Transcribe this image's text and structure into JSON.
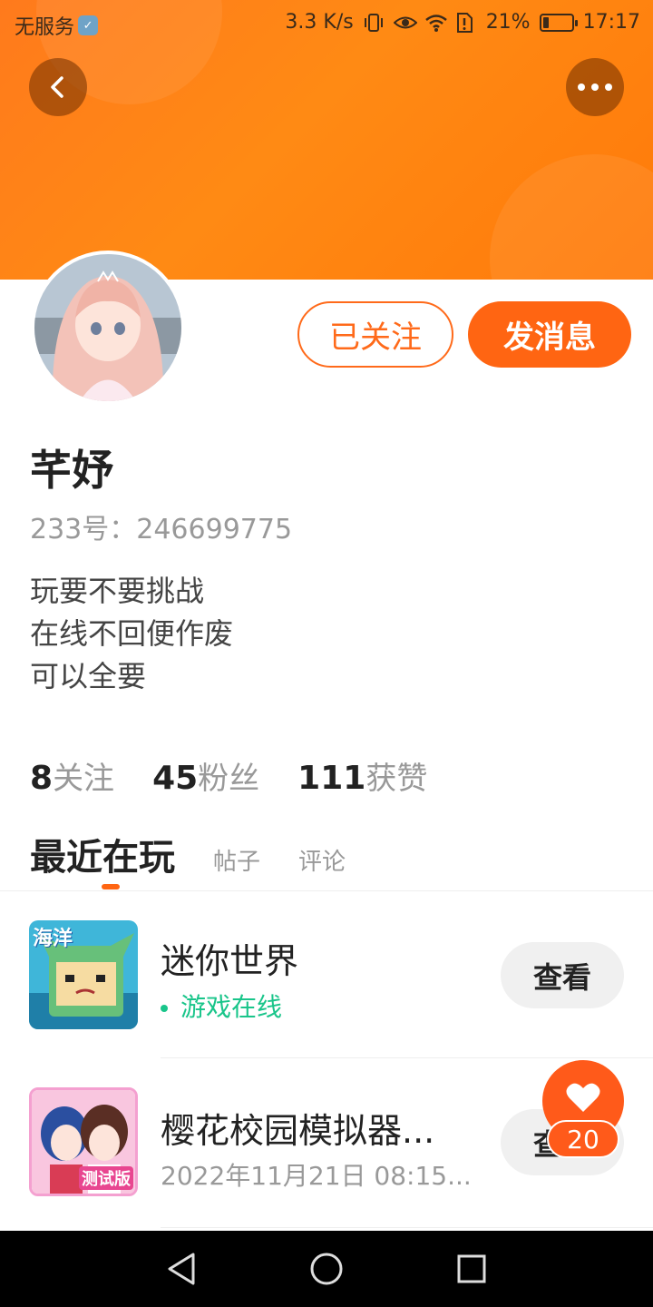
{
  "status_bar": {
    "carrier": "无服务",
    "network_speed": "3.3 K/s",
    "battery_percent": "21%",
    "battery_level": 0.21,
    "time": "17:17"
  },
  "profile": {
    "name": "芊妤",
    "id_label": "233号：246699775",
    "bio": [
      "玩要不要挑战",
      "在线不回便作废",
      "可以全要"
    ],
    "followed_label": "已关注",
    "message_label": "发消息"
  },
  "stats": [
    {
      "value": "8",
      "label": "关注"
    },
    {
      "value": "45",
      "label": "粉丝"
    },
    {
      "value": "111",
      "label": "获赞"
    }
  ],
  "tabs": {
    "recent": "最近在玩",
    "posts": "帖子",
    "comments": "评论"
  },
  "games": [
    {
      "title": "迷你世界",
      "status": "游戏在线",
      "button": "查看",
      "icon_text": "海洋",
      "status_color": "#19c58a"
    },
    {
      "title": "樱花校园模拟器...",
      "status": "2022年11月21日 08:15...",
      "button": "查看",
      "icon_text": "测试版"
    }
  ],
  "like_float": {
    "count": "20"
  },
  "colors": {
    "accent": "#ff6512",
    "online": "#19c58a"
  }
}
